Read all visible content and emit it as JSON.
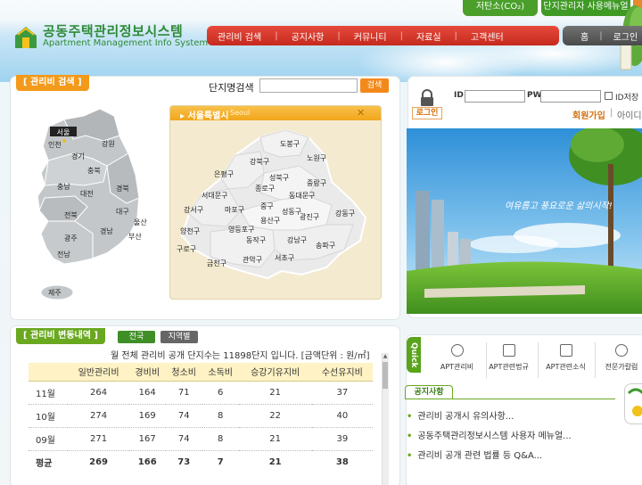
{
  "header": {
    "logo_title": "공동주택관리정보시스템",
    "logo_sub": "Apartment Management Info System",
    "top_buttons": [
      "저탄소(CO₂)",
      "단지관리자 사용메뉴얼"
    ],
    "nav": [
      "관리비 검색",
      "공지사항",
      "커뮤니티",
      "자료실",
      "고객센터"
    ],
    "nav_right": [
      "홈",
      "로그인"
    ],
    "nav_separator": "|"
  },
  "search_panel": {
    "title": "관리비 검색",
    "search_label": "단지명검색",
    "search_value": "",
    "search_button": "검색"
  },
  "korea_map": {
    "provinces": [
      "서울",
      "인천",
      "경기",
      "강원",
      "충북",
      "충남",
      "대전",
      "경북",
      "전북",
      "대구",
      "울산",
      "광주",
      "경남",
      "부산",
      "전남",
      "제주"
    ]
  },
  "seoul_popup": {
    "title": "서울특별시",
    "subtitle": "Seoul",
    "close": "✕",
    "districts": [
      "도봉구",
      "강북구",
      "노원구",
      "은평구",
      "성북구",
      "중랑구",
      "종로구",
      "동대문구",
      "서대문구",
      "중구",
      "강서구",
      "마포구",
      "성동구",
      "광진구",
      "강동구",
      "양천구",
      "용산구",
      "영등포구",
      "동작구",
      "송파구",
      "구로구",
      "강남구",
      "금천구",
      "관악구",
      "서초구"
    ]
  },
  "login": {
    "id_label": "ID",
    "pw_label": "PW",
    "save_label": "ID저장",
    "login_button": "로그인",
    "join": "회원가입",
    "find": "아이디",
    "separator": "|"
  },
  "banner": {
    "slogan": "여유롭고 풍요로운 삶의시작!"
  },
  "fee_panel": {
    "title": "관리비 변동내역",
    "tabs": [
      "전국",
      "지역별"
    ],
    "summary": "월 전체 관리비 공개 단지수는 11898단지 입니다. [금액단위 : 원/㎡]",
    "columns": [
      "",
      "일반관리비",
      "경비비",
      "청소비",
      "소독비",
      "승강기유지비",
      "수선유지비"
    ],
    "rows": [
      [
        "11월",
        "264",
        "164",
        "71",
        "6",
        "21",
        "37"
      ],
      [
        "10월",
        "274",
        "169",
        "74",
        "8",
        "22",
        "40"
      ],
      [
        "09월",
        "271",
        "167",
        "74",
        "8",
        "21",
        "39"
      ],
      [
        "평균",
        "269",
        "166",
        "73",
        "7",
        "21",
        "38"
      ]
    ]
  },
  "quick": {
    "label": "Quick",
    "items": [
      "APT관리비",
      "APT관련법규",
      "APT관련소식",
      "전문가칼럼"
    ]
  },
  "notice": {
    "tab": "공지사항",
    "bullet": "•",
    "items": [
      "관리비 공개시 유의사항...",
      "공동주택관리정보시스템 사용자 메뉴얼...",
      "관리비 공개 관련 법률 등 Q&A..."
    ]
  },
  "colors": {
    "brand_green": "#2d8a36",
    "nav_red": "#d43526",
    "accent_orange": "#f3891b",
    "fee_green": "#6aa820"
  }
}
